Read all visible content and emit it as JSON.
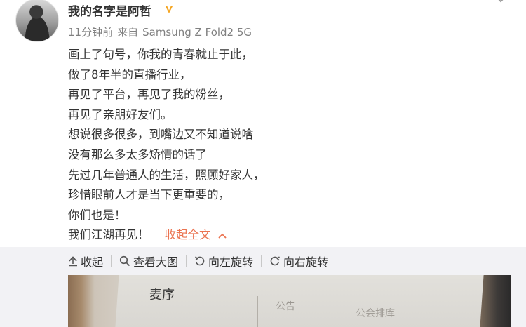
{
  "post": {
    "user_name": "我的名字是阿哲",
    "time": "11分钟前",
    "source_prefix": "来自",
    "device": "Samsung Z Fold2 5G",
    "content_lines": [
      "画上了句号，你我的青春就止于此，",
      "做了8年半的直播行业，",
      "再见了平台，再见了我的粉丝，",
      "再见了亲朋好友们。",
      "想说很多很多，到嘴边又不知道说啥",
      "没有那么多太多矫情的话了",
      "先过几年普通人的生活，照顾好家人，",
      "珍惜眼前人才是当下更重要的，",
      "你们也是！",
      "我们江湖再见！"
    ],
    "collapse_label": "收起全文"
  },
  "media_toolbar": {
    "collapse": "收起",
    "view_large": "查看大图",
    "rotate_left": "向左旋转",
    "rotate_right": "向右旋转"
  },
  "photo": {
    "text_1": "麦序",
    "text_2": "公告",
    "text_3": "公会排库"
  },
  "colors": {
    "link_accent": "#eb7350",
    "verified_badge": "#f5a623",
    "meta_text": "#808080",
    "media_panel_bg": "#f2f2f5"
  },
  "icons": [
    "verified-badge-icon",
    "chevron-down-icon",
    "arrow-up-icon",
    "magnifier-icon",
    "rotate-left-icon",
    "rotate-right-icon",
    "chevron-up-icon"
  ]
}
